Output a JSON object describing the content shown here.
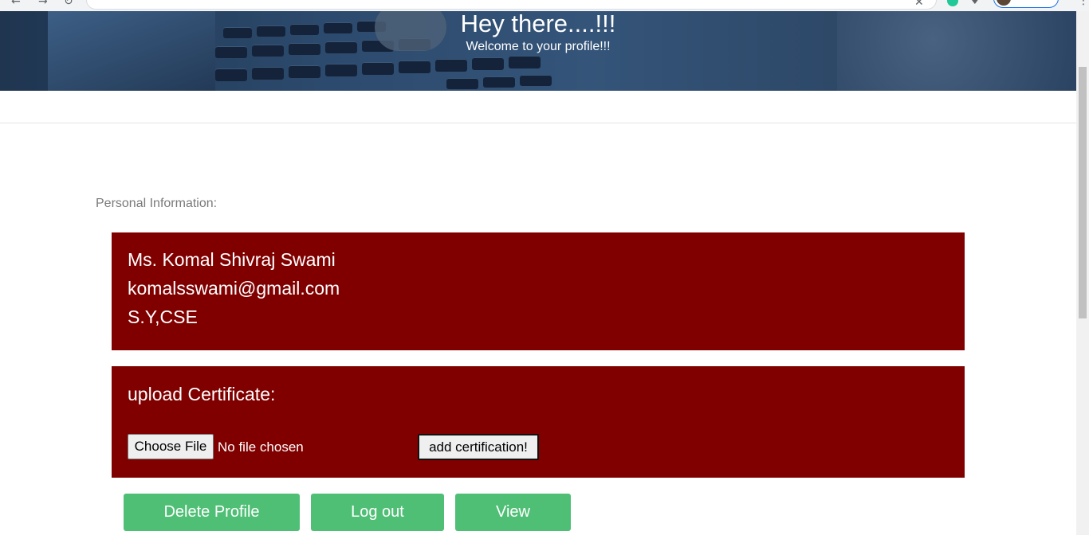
{
  "hero": {
    "title": "Hey there....!!!",
    "subtitle": "Welcome to your profile!!!"
  },
  "personal_info": {
    "label": "Personal Information:",
    "name": "Ms. Komal Shivraj Swami",
    "email": "komalsswami@gmail.com",
    "class": "S.Y,CSE"
  },
  "upload": {
    "title": "upload Certificate:",
    "choose_label": "Choose File",
    "file_status": "No file chosen",
    "submit_label": "add certification!"
  },
  "actions": {
    "delete_label": "Delete Profile",
    "logout_label": "Log out",
    "view_label": "View"
  },
  "colors": {
    "panel": "#800000",
    "action_button": "#50bf76",
    "hero_overlay": "#2c4a6d"
  },
  "icons": [
    "back-icon",
    "forward-icon",
    "reload-icon",
    "star-icon",
    "extension-icon",
    "puzzle-icon",
    "profile-avatar",
    "more-icon"
  ]
}
